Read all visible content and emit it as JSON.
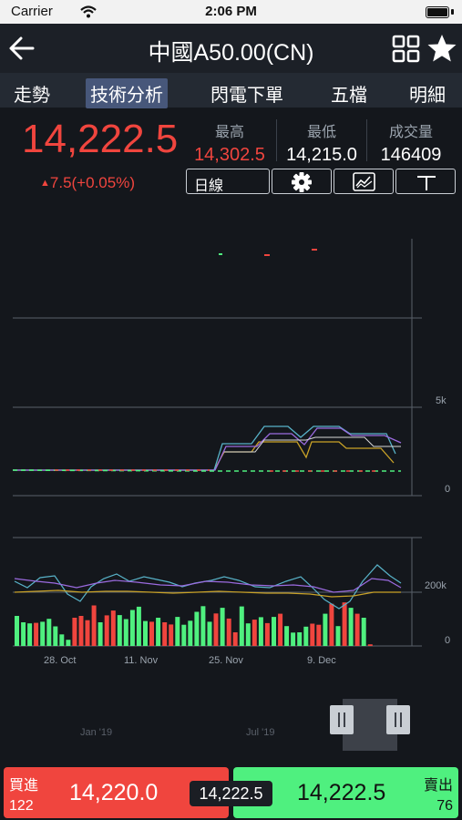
{
  "status": {
    "carrier": "Carrier",
    "time": "2:06 PM"
  },
  "header": {
    "title": "中國A50.00(CN)"
  },
  "tabs": [
    {
      "label": "走勢"
    },
    {
      "label": "技術分析",
      "active": true
    },
    {
      "label": "閃電下單"
    },
    {
      "label": "五檔"
    },
    {
      "label": "明細"
    }
  ],
  "quote": {
    "price": "14,222.5",
    "change": "7.5(+0.05%)",
    "high_label": "最高",
    "high": "14,302.5",
    "low_label": "最低",
    "low": "14,215.0",
    "volume_label": "成交量",
    "volume": "146409"
  },
  "toolbar": {
    "period": "日線"
  },
  "price_axis": {
    "labels": [
      "5k",
      "0"
    ]
  },
  "volume_axis": {
    "labels": [
      "200k",
      "0"
    ]
  },
  "date_labels": [
    "28. Oct",
    "11. Nov",
    "25. Nov",
    "9. Dec"
  ],
  "navigator_labels": [
    "Jan '19",
    "Jul '19"
  ],
  "trade": {
    "buy_label": "買進",
    "buy_price": "14,220.0",
    "buy_qty": "122",
    "last_price": "14,222.5",
    "sell_label": "賣出",
    "sell_price": "14,222.5",
    "sell_qty": "76"
  },
  "colors": {
    "up": "#f0453e",
    "down": "#4ff07f",
    "nav_bg": "#1c2027",
    "tab_bg": "#242a33",
    "active_tab": "#47577a"
  },
  "chart_data": {
    "type": "bar",
    "volume": [
      112,
      88,
      84,
      86,
      90,
      101,
      73,
      43,
      23,
      105,
      112,
      96,
      151,
      88,
      114,
      132,
      115,
      100,
      134,
      146,
      93,
      90,
      105,
      88,
      80,
      108,
      79,
      94,
      127,
      148,
      90,
      121,
      142,
      102,
      51,
      147,
      84,
      98,
      107,
      85,
      108,
      120,
      74,
      50,
      51,
      72,
      83,
      79,
      120,
      157,
      74,
      162,
      142,
      120,
      105,
      6
    ],
    "volume_colors": [
      "down",
      "down",
      "down",
      "up",
      "down",
      "down",
      "down",
      "down",
      "down",
      "up",
      "up",
      "up",
      "up",
      "down",
      "up",
      "up",
      "down",
      "down",
      "down",
      "down",
      "down",
      "up",
      "down",
      "up",
      "up",
      "down",
      "down",
      "down",
      "down",
      "down",
      "down",
      "up",
      "down",
      "up",
      "up",
      "down",
      "down",
      "up",
      "down",
      "up",
      "down",
      "up",
      "down",
      "down",
      "down",
      "down",
      "up",
      "up",
      "down",
      "up",
      "down",
      "up",
      "down",
      "up",
      "down",
      "up"
    ]
  }
}
